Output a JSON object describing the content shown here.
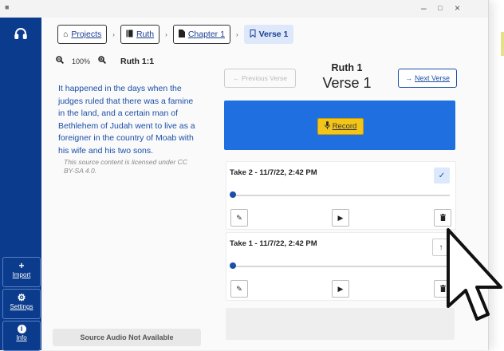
{
  "window": {
    "controls": [
      "–",
      "□",
      "×"
    ]
  },
  "sidebar": {
    "top_icon": "headphones-icon",
    "buttons": [
      {
        "label": "Import",
        "glyph": "+"
      },
      {
        "label": "Settings",
        "glyph": "⚙"
      },
      {
        "label": "Info",
        "glyph": "i"
      }
    ]
  },
  "breadcrumb": [
    {
      "label": "Projects",
      "icon": "home-icon"
    },
    {
      "label": "Ruth",
      "icon": "book-icon"
    },
    {
      "label": "Chapter 1",
      "icon": "document-icon"
    },
    {
      "label": "Verse 1",
      "icon": "bookmark-icon"
    }
  ],
  "source": {
    "zoom_level": "100%",
    "reference": "Ruth 1:1",
    "text": "It happened in the days when the judges ruled that there was a famine in the land, and a certain man of Bethlehem of Judah went to live as a foreigner in the country of Moab with his wife and his two sons.",
    "license": "This source content is licensed under CC BY-SA 4.0.",
    "audio_status": "Source Audio Not Available"
  },
  "navigation": {
    "previous_label": "Previous Verse",
    "next_label": "Next Verse"
  },
  "heading": {
    "book_chapter": "Ruth 1",
    "verse": "Verse 1"
  },
  "record": {
    "label": "Record"
  },
  "takes": [
    {
      "title": "Take 2 - 11/7/22, 2:42 PM",
      "status_icon": "check-icon",
      "progress": 0
    },
    {
      "title": "Take 1 - 11/7/22, 2:42 PM",
      "status_icon": "arrow-up-icon",
      "progress": 0
    }
  ],
  "colors": {
    "sidebar": "#0b3b8c",
    "record_panel": "#1f6fe0",
    "record_button": "#f3c419",
    "accent": "#1a4fa8"
  }
}
